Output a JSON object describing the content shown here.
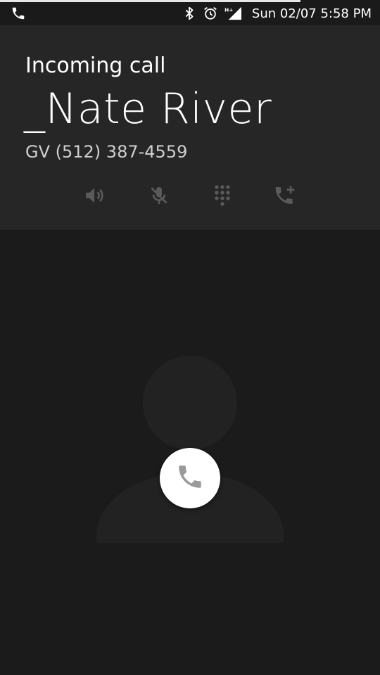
{
  "status_bar": {
    "left_icon": "phone-icon",
    "icons": [
      "bluetooth-icon",
      "alarm-icon",
      "signal-hplus-icon"
    ],
    "clock": "Sun 02/07 5:58 PM"
  },
  "call": {
    "state": "Incoming call",
    "caller_name": "_Nate River",
    "caller_number": "GV (512) 387-4559",
    "actions": [
      {
        "name": "speaker-icon"
      },
      {
        "name": "mute-icon"
      },
      {
        "name": "dialpad-icon"
      },
      {
        "name": "add-call-icon"
      }
    ]
  },
  "answer": {
    "icon": "phone-icon"
  },
  "colors": {
    "background": "#1b1b1b",
    "card": "#262626",
    "avatar": "#222222",
    "action_icon": "#5a5a5a",
    "answer_bg": "#ffffff",
    "answer_icon": "#9a9a9a"
  }
}
